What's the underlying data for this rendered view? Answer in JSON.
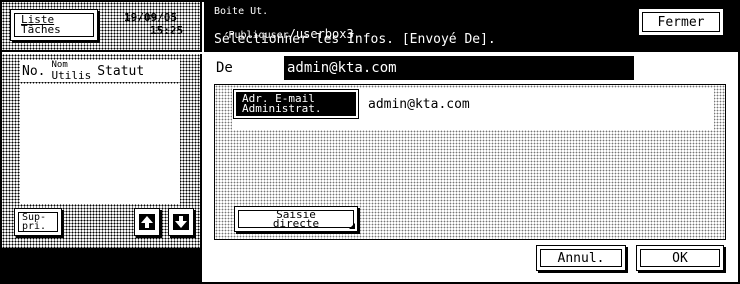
{
  "header": {
    "job_list_label_line1": "Liste",
    "job_list_label_line2": "Tâches",
    "date": "19/09/05",
    "time": "15:25",
    "title_line1": "Boite Ut.",
    "title_line2_prefix": "Publiquser",
    "title_line2_path": "/userbox3",
    "title_line3": "Sélectionner les Infos. [Envoyé De].",
    "close_label": "Fermer"
  },
  "left_panel": {
    "col_no": "No.",
    "col_user_line1": "Nom",
    "col_user_line2": "Utilis",
    "col_status": "Statut",
    "delete_label_line1": "Sup-",
    "delete_label_line2": "pri.",
    "up_icon": "arrow-up-icon",
    "down_icon": "arrow-down-icon"
  },
  "main": {
    "from_label": "De",
    "from_value": "admin@kta.com",
    "admin_button_line1": "Adr. E-mail",
    "admin_button_line2": "Administrat.",
    "admin_value": "admin@kta.com",
    "direct_entry_line1": "Saisie",
    "direct_entry_line2": "directe",
    "cancel_label": "Annul.",
    "ok_label": "OK"
  }
}
